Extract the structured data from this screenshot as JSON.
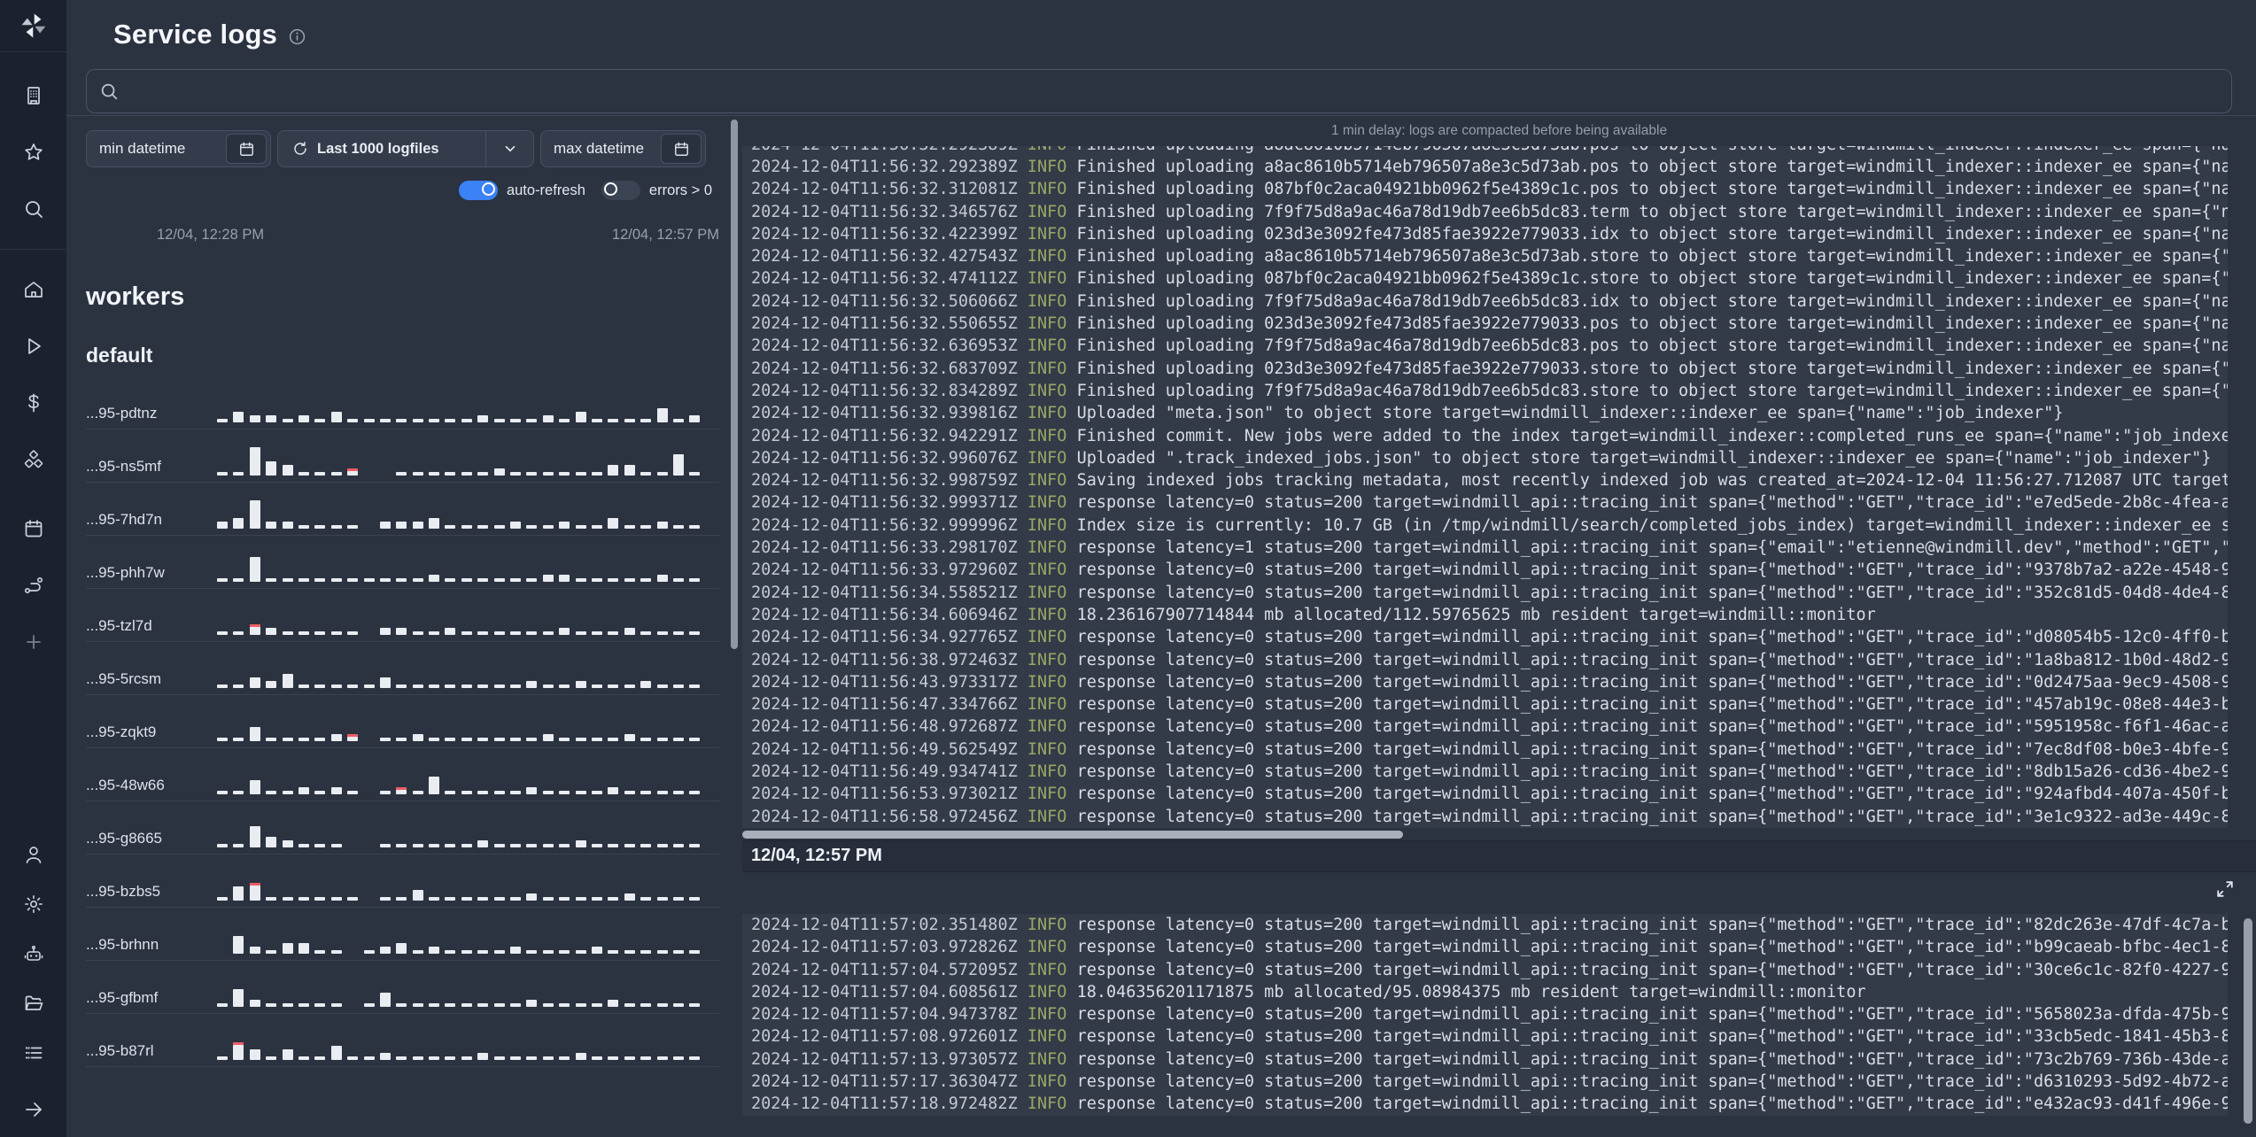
{
  "colors": {
    "page_bg": "#2b3240",
    "accent": "#3b82f6",
    "info": "#9aa765",
    "error": "#ef5d64",
    "bar": "#e9ecf1"
  },
  "header": {
    "title": "Service logs"
  },
  "sidebar": {
    "icons": [
      "windmill-logo",
      "building",
      "star",
      "search",
      "home",
      "play",
      "dollar",
      "cubes",
      "calendar",
      "route",
      "plus",
      "user",
      "gear",
      "robot",
      "folder",
      "list",
      "arrow-right"
    ]
  },
  "search": {
    "value": "",
    "placeholder": ""
  },
  "filters": {
    "min_datetime_label": "min datetime",
    "logfiles_label": "Last 1000 logfiles",
    "max_datetime_label": "max datetime",
    "auto_refresh_label": "auto-refresh",
    "errors_label": "errors > 0",
    "range_start": "12/04, 12:28 PM",
    "range_end": "12/04, 12:57 PM"
  },
  "workers": {
    "heading": "workers",
    "group": "default",
    "rows": [
      {
        "name": "...95-pdtnz",
        "bars": [
          1,
          3,
          2,
          2,
          1,
          2,
          1,
          3,
          1,
          1,
          1,
          1,
          1,
          1,
          1,
          1,
          2,
          1,
          1,
          1,
          2,
          1,
          3,
          1,
          1,
          1,
          1,
          4,
          1,
          2
        ]
      },
      {
        "name": "...95-ns5mf",
        "bars": [
          1,
          1,
          8,
          4,
          3,
          1,
          1,
          1,
          -2,
          0,
          0,
          1,
          1,
          1,
          1,
          1,
          1,
          2,
          1,
          1,
          1,
          1,
          1,
          1,
          3,
          3,
          1,
          1,
          6,
          1
        ]
      },
      {
        "name": "...95-7hd7n",
        "bars": [
          2,
          3,
          8,
          2,
          2,
          1,
          1,
          1,
          1,
          0,
          2,
          2,
          2,
          3,
          1,
          1,
          1,
          1,
          2,
          1,
          1,
          2,
          1,
          1,
          3,
          1,
          1,
          2,
          1,
          1
        ]
      },
      {
        "name": "...95-phh7w",
        "bars": [
          1,
          1,
          7,
          1,
          1,
          1,
          1,
          1,
          1,
          1,
          1,
          1,
          1,
          2,
          1,
          1,
          1,
          1,
          1,
          1,
          2,
          2,
          1,
          1,
          1,
          1,
          1,
          2,
          1,
          1
        ]
      },
      {
        "name": "...95-tzl7d",
        "bars": [
          1,
          1,
          -3,
          2,
          1,
          1,
          1,
          1,
          1,
          0,
          2,
          2,
          1,
          1,
          2,
          1,
          1,
          1,
          1,
          1,
          1,
          2,
          1,
          1,
          1,
          2,
          1,
          1,
          1,
          1
        ]
      },
      {
        "name": "...95-5rcsm",
        "bars": [
          1,
          1,
          3,
          2,
          4,
          1,
          1,
          1,
          1,
          1,
          3,
          1,
          1,
          1,
          1,
          1,
          1,
          1,
          1,
          2,
          1,
          1,
          2,
          1,
          1,
          1,
          2,
          1,
          1,
          1
        ]
      },
      {
        "name": "...95-zqkt9",
        "bars": [
          1,
          1,
          4,
          1,
          1,
          1,
          1,
          2,
          -2,
          0,
          1,
          1,
          2,
          1,
          1,
          1,
          1,
          1,
          1,
          1,
          2,
          1,
          1,
          1,
          1,
          2,
          1,
          1,
          1,
          1
        ]
      },
      {
        "name": "...95-48w66",
        "bars": [
          1,
          1,
          4,
          1,
          1,
          2,
          1,
          2,
          1,
          0,
          1,
          -2,
          1,
          5,
          1,
          1,
          1,
          1,
          1,
          2,
          1,
          1,
          1,
          1,
          2,
          1,
          1,
          1,
          1,
          1
        ]
      },
      {
        "name": "...95-g8665",
        "bars": [
          1,
          1,
          6,
          3,
          2,
          1,
          1,
          1,
          0,
          0,
          1,
          1,
          1,
          1,
          1,
          1,
          2,
          1,
          1,
          1,
          1,
          1,
          2,
          1,
          1,
          1,
          1,
          1,
          1,
          1
        ]
      },
      {
        "name": "...95-bzbs5",
        "bars": [
          1,
          4,
          -5,
          1,
          1,
          1,
          1,
          1,
          1,
          0,
          1,
          1,
          3,
          1,
          1,
          1,
          1,
          1,
          1,
          2,
          1,
          1,
          1,
          1,
          1,
          2,
          1,
          1,
          1,
          1
        ]
      },
      {
        "name": "...95-brhnn",
        "bars": [
          0,
          5,
          2,
          1,
          3,
          3,
          1,
          1,
          0,
          1,
          2,
          3,
          1,
          2,
          1,
          1,
          1,
          1,
          2,
          1,
          1,
          1,
          1,
          2,
          1,
          1,
          1,
          1,
          1,
          1
        ]
      },
      {
        "name": "...95-gfbmf",
        "bars": [
          1,
          5,
          2,
          1,
          1,
          1,
          1,
          1,
          0,
          1,
          4,
          1,
          1,
          1,
          1,
          1,
          1,
          1,
          1,
          2,
          1,
          1,
          1,
          1,
          2,
          1,
          1,
          1,
          1,
          1
        ]
      },
      {
        "name": "...95-b87rl",
        "bars": [
          1,
          -5,
          3,
          1,
          3,
          1,
          1,
          4,
          1,
          1,
          2,
          1,
          1,
          1,
          1,
          1,
          2,
          1,
          1,
          1,
          1,
          1,
          2,
          1,
          1,
          1,
          1,
          1,
          1,
          1
        ]
      }
    ]
  },
  "logs": {
    "notice": "1 min delay: logs are compacted before being available",
    "separator": "12/04, 12:57 PM",
    "block1": {
      "lines": [
        {
          "ts": "2024-12-04T11:56:32.292389Z",
          "level": "INFO",
          "msg": "Finished uploading a8ac8610b5714eb796507a8e3c5d73ab.pos to object store target=windmill_indexer::indexer_ee span={\"na"
        },
        {
          "ts": "2024-12-04T11:56:32.312081Z",
          "level": "INFO",
          "msg": "Finished uploading 087bf0c2aca04921bb0962f5e4389c1c.pos to object store target=windmill_indexer::indexer_ee span={\"na"
        },
        {
          "ts": "2024-12-04T11:56:32.346576Z",
          "level": "INFO",
          "msg": "Finished uploading 7f9f75d8a9ac46a78d19db7ee6b5dc83.term to object store target=windmill_indexer::indexer_ee span={\"n"
        },
        {
          "ts": "2024-12-04T11:56:32.422399Z",
          "level": "INFO",
          "msg": "Finished uploading 023d3e3092fe473d85fae3922e779033.idx to object store target=windmill_indexer::indexer_ee span={\"na"
        },
        {
          "ts": "2024-12-04T11:56:32.427543Z",
          "level": "INFO",
          "msg": "Finished uploading a8ac8610b5714eb796507a8e3c5d73ab.store to object store target=windmill_indexer::indexer_ee span={\""
        },
        {
          "ts": "2024-12-04T11:56:32.474112Z",
          "level": "INFO",
          "msg": "Finished uploading 087bf0c2aca04921bb0962f5e4389c1c.store to object store target=windmill_indexer::indexer_ee span={\""
        },
        {
          "ts": "2024-12-04T11:56:32.506066Z",
          "level": "INFO",
          "msg": "Finished uploading 7f9f75d8a9ac46a78d19db7ee6b5dc83.idx to object store target=windmill_indexer::indexer_ee span={\"na"
        },
        {
          "ts": "2024-12-04T11:56:32.550655Z",
          "level": "INFO",
          "msg": "Finished uploading 023d3e3092fe473d85fae3922e779033.pos to object store target=windmill_indexer::indexer_ee span={\"na"
        },
        {
          "ts": "2024-12-04T11:56:32.636953Z",
          "level": "INFO",
          "msg": "Finished uploading 7f9f75d8a9ac46a78d19db7ee6b5dc83.pos to object store target=windmill_indexer::indexer_ee span={\"na"
        },
        {
          "ts": "2024-12-04T11:56:32.683709Z",
          "level": "INFO",
          "msg": "Finished uploading 023d3e3092fe473d85fae3922e779033.store to object store target=windmill_indexer::indexer_ee span={\""
        },
        {
          "ts": "2024-12-04T11:56:32.834289Z",
          "level": "INFO",
          "msg": "Finished uploading 7f9f75d8a9ac46a78d19db7ee6b5dc83.store to object store target=windmill_indexer::indexer_ee span={\""
        },
        {
          "ts": "2024-12-04T11:56:32.939816Z",
          "level": "INFO",
          "msg": "Uploaded \"meta.json\" to object store target=windmill_indexer::indexer_ee span={\"name\":\"job_indexer\"}"
        },
        {
          "ts": "2024-12-04T11:56:32.942291Z",
          "level": "INFO",
          "msg": "Finished commit. New jobs were added to the index target=windmill_indexer::completed_runs_ee span={\"name\":\"job_indexe"
        },
        {
          "ts": "2024-12-04T11:56:32.996076Z",
          "level": "INFO",
          "msg": "Uploaded \".track_indexed_jobs.json\" to object store target=windmill_indexer::indexer_ee span={\"name\":\"job_indexer\"}"
        },
        {
          "ts": "2024-12-04T11:56:32.998759Z",
          "level": "INFO",
          "msg": "Saving indexed jobs tracking metadata, most recently indexed job was created_at=2024-12-04 11:56:27.712087 UTC target"
        },
        {
          "ts": "2024-12-04T11:56:32.999371Z",
          "level": "INFO",
          "msg": "response latency=0 status=200 target=windmill_api::tracing_init span={\"method\":\"GET\",\"trace_id\":\"e7ed5ede-2b8c-4fea-a"
        },
        {
          "ts": "2024-12-04T11:56:32.999996Z",
          "level": "INFO",
          "msg": "Index size is currently: 10.7 GB (in /tmp/windmill/search/completed_jobs_index) target=windmill_indexer::indexer_ee s"
        },
        {
          "ts": "2024-12-04T11:56:33.298170Z",
          "level": "INFO",
          "msg": "response latency=1 status=200 target=windmill_api::tracing_init span={\"email\":\"etienne@windmill.dev\",\"method\":\"GET\",\""
        },
        {
          "ts": "2024-12-04T11:56:33.972960Z",
          "level": "INFO",
          "msg": "response latency=0 status=200 target=windmill_api::tracing_init span={\"method\":\"GET\",\"trace_id\":\"9378b7a2-a22e-4548-9"
        },
        {
          "ts": "2024-12-04T11:56:34.558521Z",
          "level": "INFO",
          "msg": "response latency=0 status=200 target=windmill_api::tracing_init span={\"method\":\"GET\",\"trace_id\":\"352c81d5-04d8-4de4-8"
        },
        {
          "ts": "2024-12-04T11:56:34.606946Z",
          "level": "INFO",
          "msg": "18.236167907714844 mb allocated/112.59765625 mb resident target=windmill::monitor"
        },
        {
          "ts": "2024-12-04T11:56:34.927765Z",
          "level": "INFO",
          "msg": "response latency=0 status=200 target=windmill_api::tracing_init span={\"method\":\"GET\",\"trace_id\":\"d08054b5-12c0-4ff0-b"
        },
        {
          "ts": "2024-12-04T11:56:38.972463Z",
          "level": "INFO",
          "msg": "response latency=0 status=200 target=windmill_api::tracing_init span={\"method\":\"GET\",\"trace_id\":\"1a8ba812-1b0d-48d2-9"
        },
        {
          "ts": "2024-12-04T11:56:43.973317Z",
          "level": "INFO",
          "msg": "response latency=0 status=200 target=windmill_api::tracing_init span={\"method\":\"GET\",\"trace_id\":\"0d2475aa-9ec9-4508-9"
        },
        {
          "ts": "2024-12-04T11:56:47.334766Z",
          "level": "INFO",
          "msg": "response latency=0 status=200 target=windmill_api::tracing_init span={\"method\":\"GET\",\"trace_id\":\"457ab19c-08e8-44e3-b"
        },
        {
          "ts": "2024-12-04T11:56:48.972687Z",
          "level": "INFO",
          "msg": "response latency=0 status=200 target=windmill_api::tracing_init span={\"method\":\"GET\",\"trace_id\":\"5951958c-f6f1-46ac-a"
        },
        {
          "ts": "2024-12-04T11:56:49.562549Z",
          "level": "INFO",
          "msg": "response latency=0 status=200 target=windmill_api::tracing_init span={\"method\":\"GET\",\"trace_id\":\"7ec8df08-b0e3-4bfe-9"
        },
        {
          "ts": "2024-12-04T11:56:49.934741Z",
          "level": "INFO",
          "msg": "response latency=0 status=200 target=windmill_api::tracing_init span={\"method\":\"GET\",\"trace_id\":\"8db15a26-cd36-4be2-9"
        },
        {
          "ts": "2024-12-04T11:56:53.973021Z",
          "level": "INFO",
          "msg": "response latency=0 status=200 target=windmill_api::tracing_init span={\"method\":\"GET\",\"trace_id\":\"924afbd4-407a-450f-b"
        },
        {
          "ts": "2024-12-04T11:56:58.972456Z",
          "level": "INFO",
          "msg": "response latency=0 status=200 target=windmill_api::tracing_init span={\"method\":\"GET\",\"trace_id\":\"3e1c9322-ad3e-449c-8"
        }
      ]
    },
    "block2": {
      "lines": [
        {
          "ts": "2024-12-04T11:57:02.351480Z",
          "level": "INFO",
          "msg": "response latency=0 status=200 target=windmill_api::tracing_init span={\"method\":\"GET\",\"trace_id\":\"82dc263e-47df-4c7a-b"
        },
        {
          "ts": "2024-12-04T11:57:03.972826Z",
          "level": "INFO",
          "msg": "response latency=0 status=200 target=windmill_api::tracing_init span={\"method\":\"GET\",\"trace_id\":\"b99caeab-bfbc-4ec1-8"
        },
        {
          "ts": "2024-12-04T11:57:04.572095Z",
          "level": "INFO",
          "msg": "response latency=0 status=200 target=windmill_api::tracing_init span={\"method\":\"GET\",\"trace_id\":\"30ce6c1c-82f0-4227-9"
        },
        {
          "ts": "2024-12-04T11:57:04.608561Z",
          "level": "INFO",
          "msg": "18.046356201171875 mb allocated/95.08984375 mb resident target=windmill::monitor"
        },
        {
          "ts": "2024-12-04T11:57:04.947378Z",
          "level": "INFO",
          "msg": "response latency=0 status=200 target=windmill_api::tracing_init span={\"method\":\"GET\",\"trace_id\":\"5658023a-dfda-475b-9"
        },
        {
          "ts": "2024-12-04T11:57:08.972601Z",
          "level": "INFO",
          "msg": "response latency=0 status=200 target=windmill_api::tracing_init span={\"method\":\"GET\",\"trace_id\":\"33cb5edc-1841-45b3-8"
        },
        {
          "ts": "2024-12-04T11:57:13.973057Z",
          "level": "INFO",
          "msg": "response latency=0 status=200 target=windmill_api::tracing_init span={\"method\":\"GET\",\"trace_id\":\"73c2b769-736b-43de-a"
        },
        {
          "ts": "2024-12-04T11:57:17.363047Z",
          "level": "INFO",
          "msg": "response latency=0 status=200 target=windmill_api::tracing_init span={\"method\":\"GET\",\"trace_id\":\"d6310293-5d92-4b72-a"
        },
        {
          "ts": "2024-12-04T11:57:18.972482Z",
          "level": "INFO",
          "msg": "response latency=0 status=200 target=windmill_api::tracing_init span={\"method\":\"GET\",\"trace_id\":\"e432ac93-d41f-496e-9"
        }
      ]
    }
  }
}
